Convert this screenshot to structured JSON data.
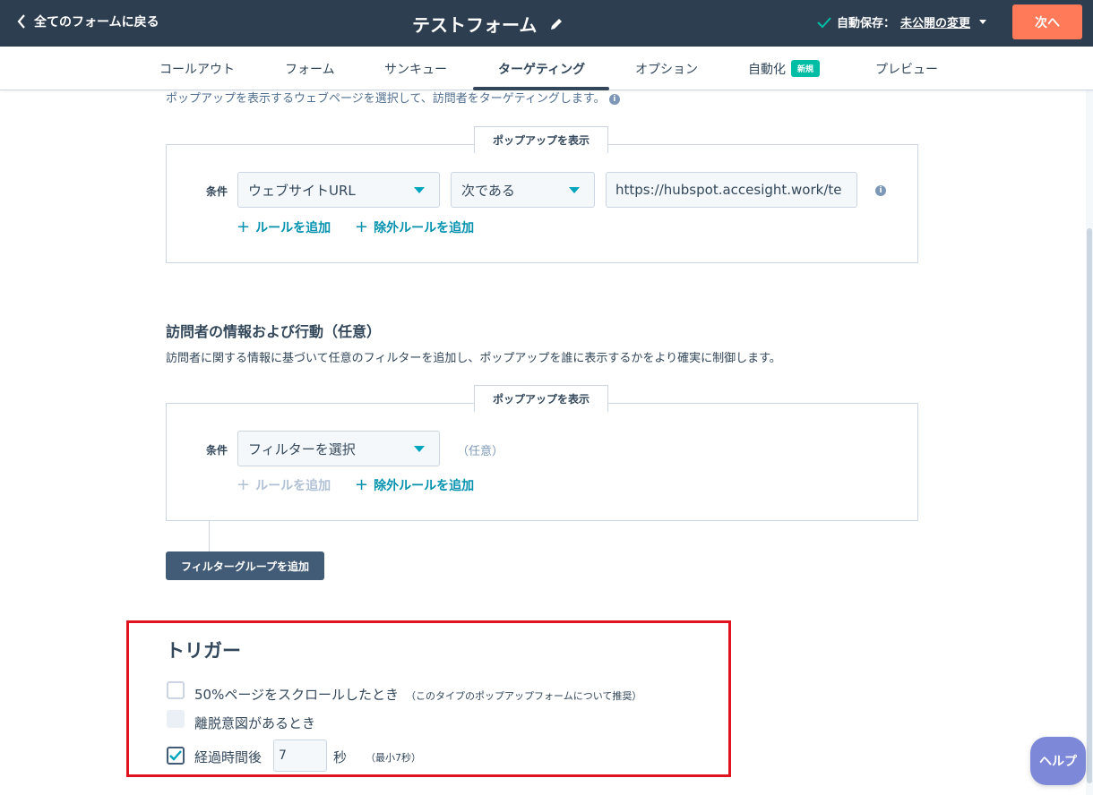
{
  "topbar": {
    "back_label": "全てのフォームに戻る",
    "title": "テストフォーム",
    "autosave_label": "自動保存：",
    "autosave_link": "未公開の変更",
    "next_label": "次へ",
    "colors": {
      "bar": "#2d3e50",
      "next": "#ff7a59",
      "check": "#00bda5"
    }
  },
  "tabs": [
    {
      "label": "コールアウト"
    },
    {
      "label": "フォーム"
    },
    {
      "label": "サンキュー"
    },
    {
      "label": "ターゲティング",
      "active": true
    },
    {
      "label": "オプション"
    },
    {
      "label": "自動化",
      "badge": "新規"
    },
    {
      "label": "プレビュー"
    }
  ],
  "targeting": {
    "intro_text": "ポップアップを表示するウェブページを選択して、訪問者をターゲティングします。",
    "info_icon": "i",
    "group1": {
      "label": "ポップアップを表示",
      "condition_label": "条件",
      "field_select": "ウェブサイトURL",
      "operator_select": "次である",
      "url_value": "https://hubspot.accesight.work/te",
      "add_rule": "ルールを追加",
      "add_exclude_rule": "除外ルールを追加"
    }
  },
  "visitor": {
    "title": "訪問者の情報および行動（任意）",
    "description": "訪問者に関する情報に基づいて任意のフィルターを追加し、ポップアップを誰に表示するかをより確実に制御します。",
    "group": {
      "label": "ポップアップを表示",
      "condition_label": "条件",
      "filter_select": "フィルターを選択",
      "optional": "（任意）",
      "add_rule": "ルールを追加",
      "add_exclude_rule": "除外ルールを追加"
    },
    "add_filter_group": "フィルターグループを追加"
  },
  "trigger": {
    "title": "トリガー",
    "options": [
      {
        "label": "50%ページをスクロールしたとき",
        "note": "（このタイプのポップアップフォームについて推奨）",
        "checked": false
      },
      {
        "label": "離脱意図があるとき",
        "checked": false,
        "disabled": true
      },
      {
        "label": "経過時間後",
        "checked": true
      }
    ],
    "seconds_value": "7",
    "seconds_unit": "秒",
    "seconds_note": "（最小7秒）"
  },
  "help_label": "ヘルプ"
}
